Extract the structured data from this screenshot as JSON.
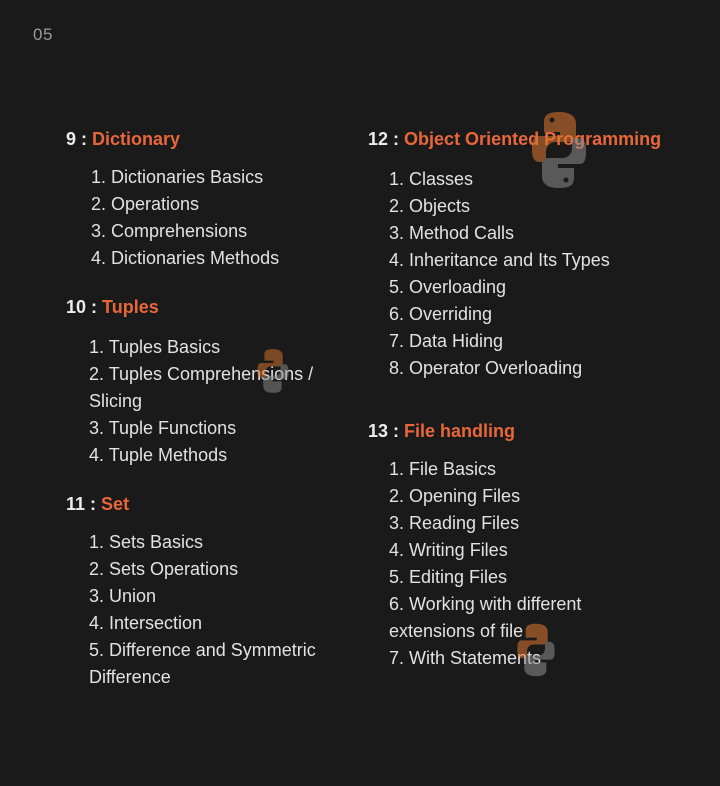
{
  "page_number": "05",
  "colors": {
    "background": "#1a1a1b",
    "accent": "#e8673a",
    "text": "#e2e2e2"
  },
  "watermark_icon": "python-logo-icon",
  "sections": [
    {
      "number": "9 :",
      "title": "Dictionary",
      "items": [
        "1. Dictionaries Basics",
        "2. Operations",
        "3. Comprehensions",
        "4. Dictionaries Methods"
      ]
    },
    {
      "number": "10 :",
      "title": "Tuples",
      "items": [
        "1. Tuples Basics",
        "2. Tuples Comprehensions / Slicing",
        "3. Tuple Functions",
        "4. Tuple Methods"
      ]
    },
    {
      "number": "11 :",
      "title": "Set",
      "items": [
        "1. Sets Basics",
        "2. Sets Operations",
        "3. Union",
        "4. Intersection",
        "5. Difference and Symmetric Difference"
      ]
    },
    {
      "number": "12 :",
      "title": "Object Oriented Programming",
      "items": [
        "1. Classes",
        "2. Objects",
        "3. Method Calls",
        "4. Inheritance and Its Types",
        "5. Overloading",
        "6. Overriding",
        "7. Data Hiding",
        "8. Operator Overloading"
      ]
    },
    {
      "number": "13 :",
      "title": "File handling",
      "items": [
        "1. File Basics",
        "2. Opening Files",
        "3. Reading Files",
        "4. Writing Files",
        "5. Editing Files",
        "6. Working with different extensions of file",
        "7. With Statements"
      ]
    }
  ]
}
